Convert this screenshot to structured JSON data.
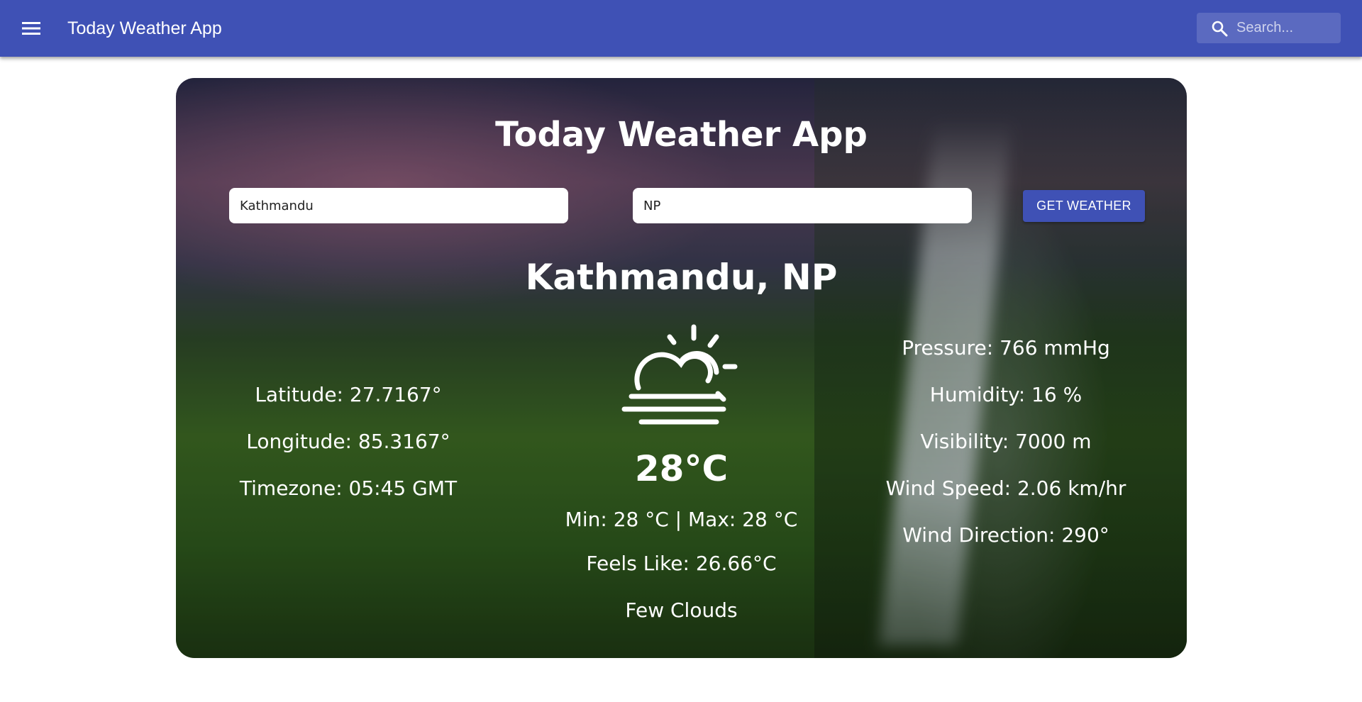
{
  "appbar": {
    "title": "Today Weather App",
    "search_placeholder": "Search...",
    "color": "#3f51b5"
  },
  "card": {
    "title": "Today Weather App",
    "city_value": "Kathmandu",
    "country_value": "NP",
    "button_label": "GET WEATHER",
    "location": "Kathmandu, NP",
    "icon": "partly-cloudy-icon",
    "temperature": "28°C",
    "minmax": "Min: 28 °C | Max: 28 °C",
    "feels_like": "Feels Like: 26.66°C",
    "description": "Few Clouds"
  },
  "left_stats": {
    "latitude": "Latitude: 27.7167°",
    "longitude": "Longitude: 85.3167°",
    "timezone": "Timezone: 05:45 GMT"
  },
  "right_stats": {
    "pressure": "Pressure: 766 mmHg",
    "humidity": "Humidity: 16 %",
    "visibility": "Visibility: 7000 m",
    "wind_speed": "Wind Speed: 2.06 km/hr",
    "wind_direction": "Wind Direction: 290°"
  }
}
